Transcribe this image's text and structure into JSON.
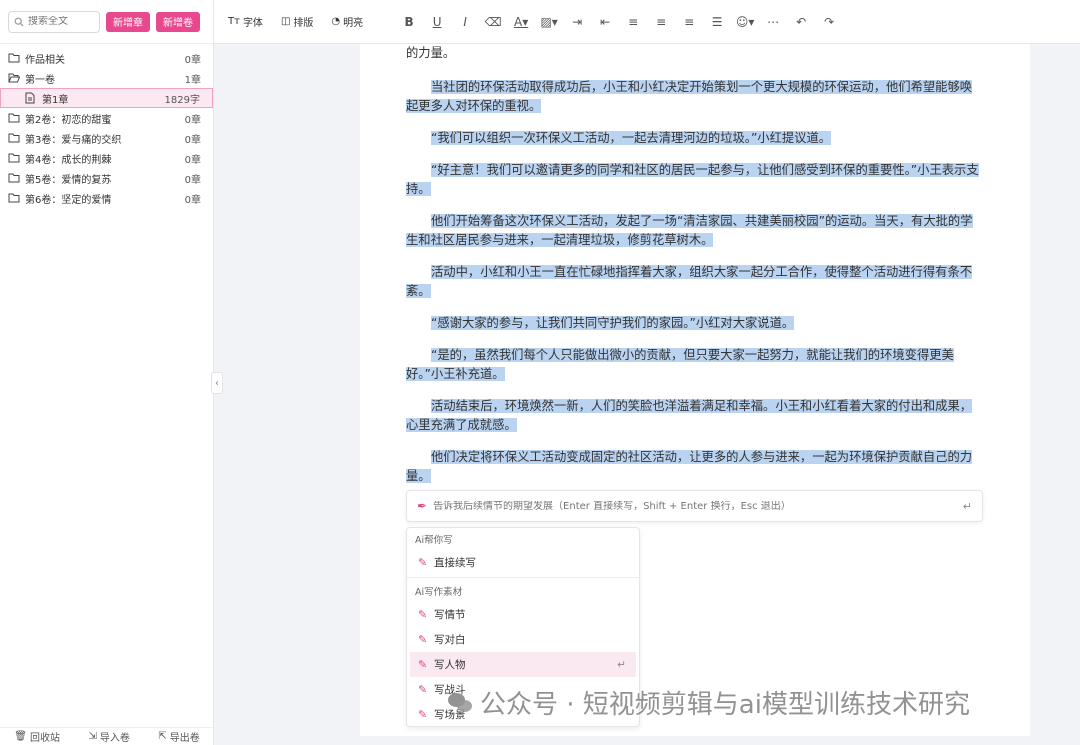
{
  "sidebar": {
    "search_placeholder": "搜索全文",
    "new_chapter": "新增章",
    "new_volume": "新增卷",
    "tree": [
      {
        "label": "作品相关",
        "count": "0章",
        "icon": "folder-icon",
        "type": "folder"
      },
      {
        "label": "第一卷",
        "count": "1章",
        "icon": "folder-open-icon",
        "type": "folder"
      },
      {
        "label": "第1章",
        "count": "1829字",
        "icon": "document-icon",
        "type": "chapter"
      },
      {
        "label": "第2卷：初恋的甜蜜",
        "count": "0章",
        "icon": "folder-icon",
        "type": "folder"
      },
      {
        "label": "第3卷：爱与痛的交织",
        "count": "0章",
        "icon": "folder-icon",
        "type": "folder"
      },
      {
        "label": "第4卷：成长的荆棘",
        "count": "0章",
        "icon": "folder-icon",
        "type": "folder"
      },
      {
        "label": "第5卷：爱情的复苏",
        "count": "0章",
        "icon": "folder-icon",
        "type": "folder"
      },
      {
        "label": "第6卷：坚定的爱情",
        "count": "0章",
        "icon": "folder-icon",
        "type": "folder"
      }
    ],
    "bottom": [
      "回收站",
      "导入卷",
      "导出卷"
    ]
  },
  "toolbar": {
    "font_label": "字体",
    "font_prefix": "Tт",
    "layout_label": "排版",
    "theme_label": "明亮"
  },
  "editor": {
    "first_line": "的力量。",
    "paragraphs": [
      "当社团的环保活动取得成功后，小王和小红决定开始策划一个更大规模的环保运动，他们希望能够唤起更多人对环保的重视。",
      "“我们可以组织一次环保义工活动，一起去清理河边的垃圾。”小红提议道。",
      "“好主意！我们可以邀请更多的同学和社区的居民一起参与，让他们感受到环保的重要性。”小王表示支持。",
      "他们开始筹备这次环保义工活动，发起了一场“清洁家园、共建美丽校园”的运动。当天，有大批的学生和社区居民参与进来，一起清理垃圾，修剪花草树木。",
      "活动中，小红和小王一直在忙碌地指挥着大家，组织大家一起分工合作，使得整个活动进行得有条不紊。",
      "“感谢大家的参与，让我们共同守护我们的家园。”小红对大家说道。",
      "“是的，虽然我们每个人只能做出微小的贡献，但只要大家一起努力，就能让我们的环境变得更美好。”小王补充道。",
      "活动结束后，环境焕然一新，人们的笑脸也洋溢着满足和幸福。小王和小红看着大家的付出和成果，心里充满了成就感。",
      "他们决定将环保义工活动变成固定的社区活动，让更多的人参与进来，一起为环境保护贡献自己的力量。"
    ]
  },
  "ai_input": {
    "placeholder": "告诉我后续情节的期望发展（Enter 直接续写，Shift + Enter 换行，Esc 退出）"
  },
  "ai_menu": {
    "section1": "Ai帮你写",
    "section1_items": [
      "直接续写"
    ],
    "section2": "Ai写作素材",
    "section2_items": [
      "写情节",
      "写对白",
      "写人物",
      "写战斗",
      "写场景"
    ]
  },
  "watermark": "公众号 · 短视频剪辑与ai模型训练技术研究",
  "colors": {
    "accent": "#e8488e",
    "highlight": "#b9d3f1"
  }
}
